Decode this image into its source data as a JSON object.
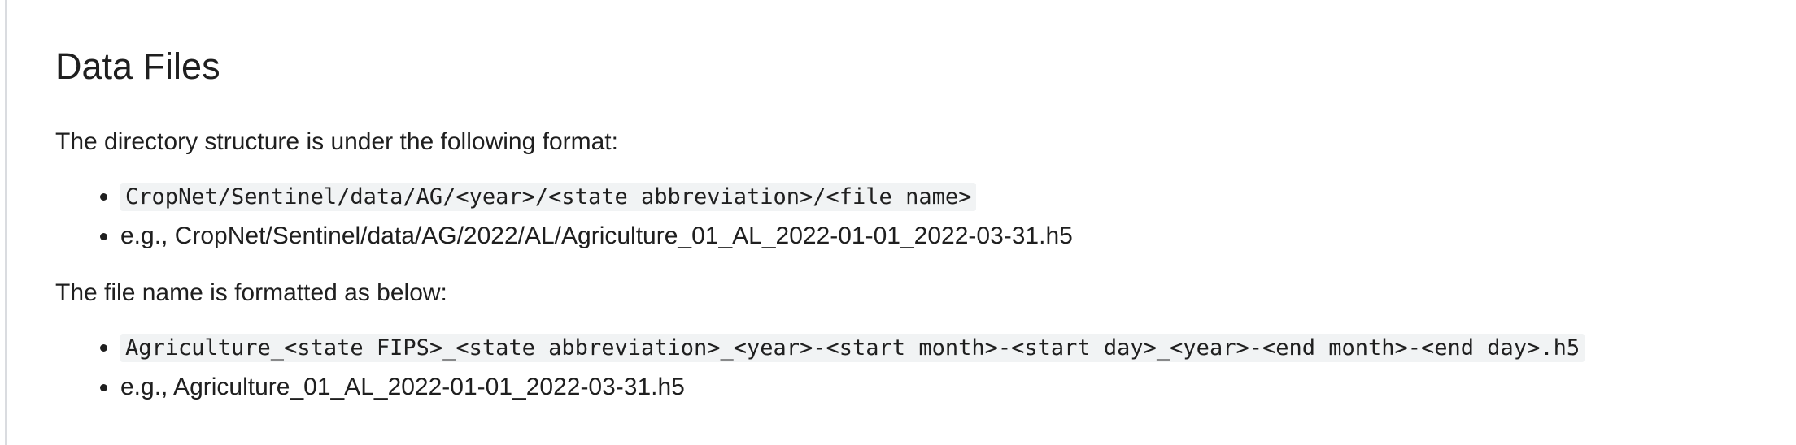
{
  "section": {
    "title": "Data Files",
    "intro_text": "The directory structure is under the following format:",
    "directory_items": [
      {
        "code": "CropNet/Sentinel/data/AG/<year>/<state abbreviation>/<file name>"
      },
      {
        "text": "e.g., CropNet/Sentinel/data/AG/2022/AL/Agriculture_01_AL_2022-01-01_2022-03-31.h5"
      }
    ],
    "filename_text": "The file name is formatted as below:",
    "filename_items": [
      {
        "code": "Agriculture_<state FIPS>_<state abbreviation>_<year>-<start month>-<start day>_<year>-<end month>-<end day>.h5"
      },
      {
        "text": "e.g., Agriculture_01_AL_2022-01-01_2022-03-31.h5"
      }
    ]
  }
}
